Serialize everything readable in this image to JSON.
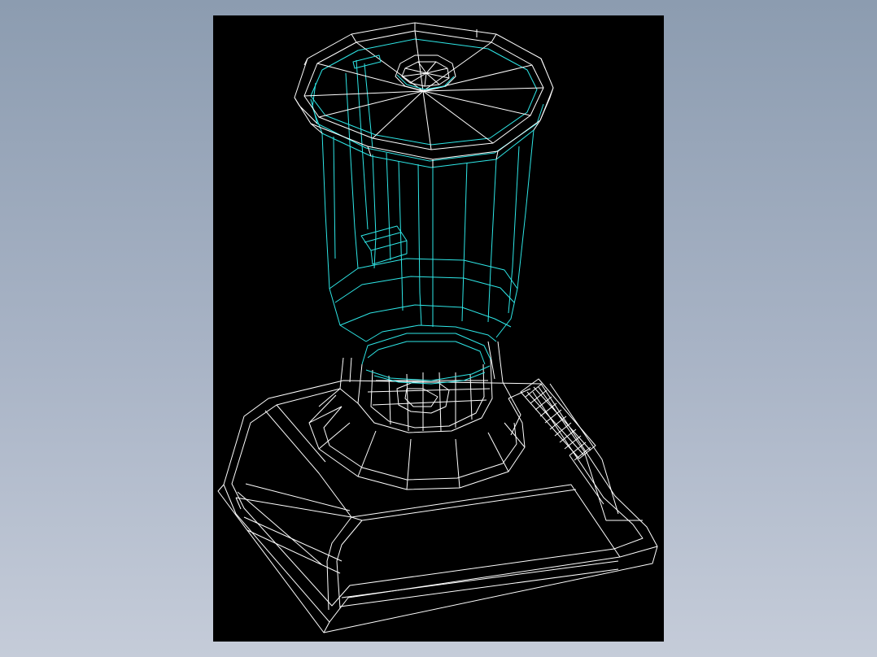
{
  "scene": {
    "subject": "blender-wireframe-model",
    "background_color": "#8c9cb0",
    "viewport_color": "#000000",
    "edge_colors": {
      "body": "#ffffff",
      "jar": "#2ee6e6"
    }
  }
}
